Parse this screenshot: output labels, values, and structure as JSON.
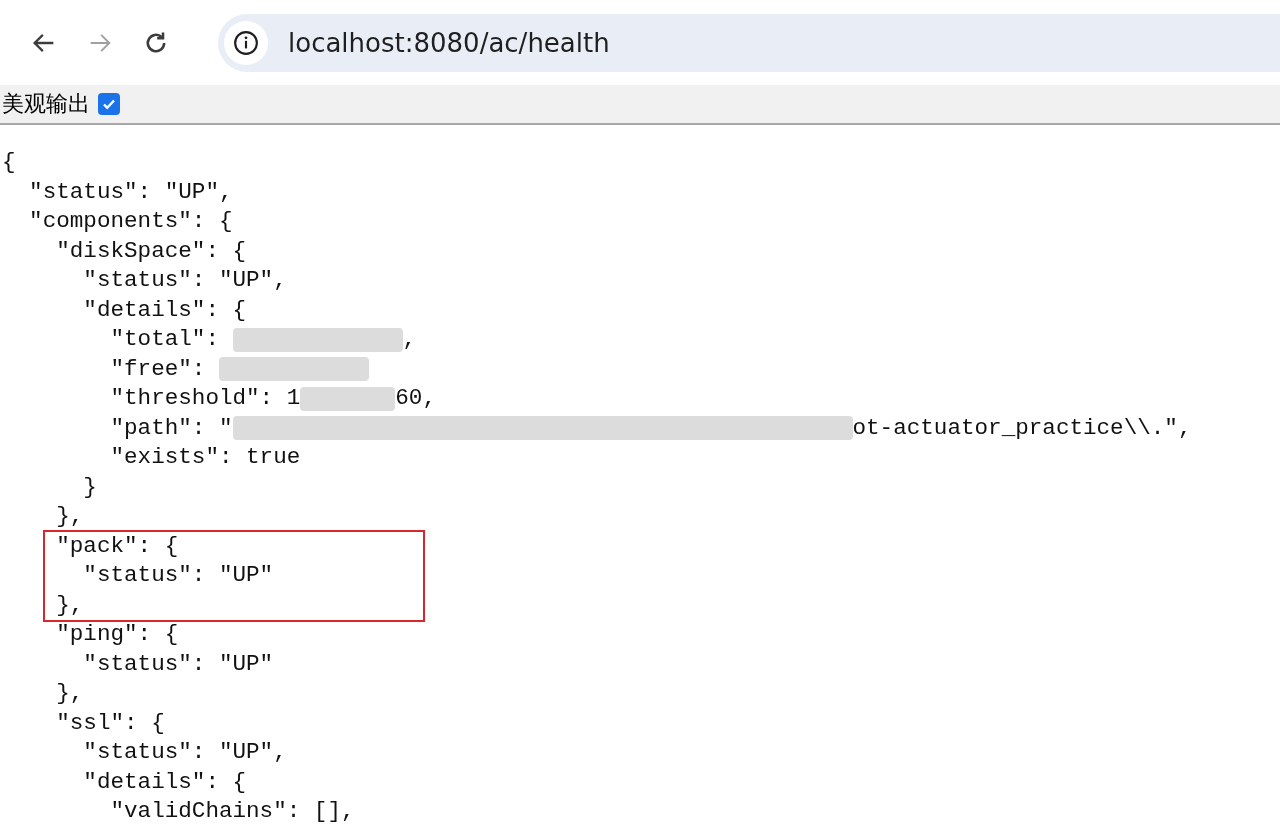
{
  "browser": {
    "url": "localhost:8080/ac/health",
    "back_enabled": true,
    "forward_enabled": false
  },
  "toolbar": {
    "label": "美观输出",
    "checked": true
  },
  "listing": {
    "lines": [
      {
        "text": "{"
      },
      {
        "text": "  \"status\": \"UP\","
      },
      {
        "text": "  \"components\": {"
      },
      {
        "text": "    \"diskSpace\": {"
      },
      {
        "text": "      \"status\": \"UP\","
      },
      {
        "text": "      \"details\": {"
      },
      {
        "text": "        \"total\": ",
        "redacted": true,
        "tail": ","
      },
      {
        "text": "        \"free\": ",
        "redacted": true
      },
      {
        "text": "        \"threshold\": 1",
        "redacted": true,
        "tail": "60,"
      },
      {
        "text": "        \"path\": \"",
        "redacted": true,
        "tail": "ot-actuator_practice\\\\.\","
      },
      {
        "text": "        \"exists\": true"
      },
      {
        "text": "      }"
      },
      {
        "text": "    },"
      },
      {
        "text": "    \"pack\": {",
        "boxed": true
      },
      {
        "text": "      \"status\": \"UP\"",
        "boxed": true
      },
      {
        "text": "    },",
        "boxed": true
      },
      {
        "text": "    \"ping\": {"
      },
      {
        "text": "      \"status\": \"UP\""
      },
      {
        "text": "    },"
      },
      {
        "text": "    \"ssl\": {"
      },
      {
        "text": "      \"status\": \"UP\","
      },
      {
        "text": "      \"details\": {"
      },
      {
        "text": "        \"validChains\": [],"
      }
    ]
  }
}
